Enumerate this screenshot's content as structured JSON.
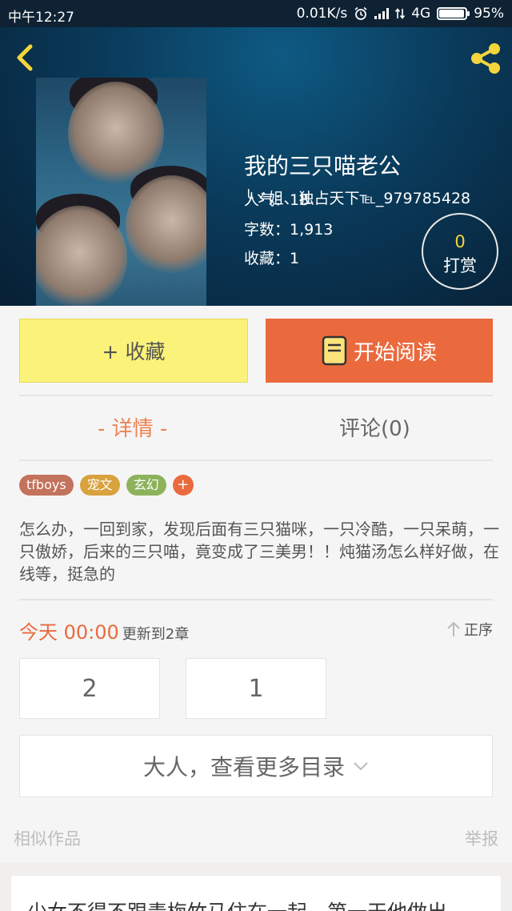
{
  "status_bar": {
    "time": "中午12:27",
    "network_speed": "0.01K/s",
    "network_type": "4G",
    "battery": "95%"
  },
  "header": {
    "back_icon": "chevron-left-icon",
    "share_icon": "share-icon"
  },
  "book": {
    "title": "我的三只喵老公",
    "author": "╰ゞ姐、独占天下℡_979785428",
    "popularity": "人气：18",
    "word_count": "字数：1,913",
    "favorites": "收藏：1"
  },
  "reward": {
    "count": "0",
    "label": "打赏"
  },
  "actions": {
    "favorite": "+ 收藏",
    "read": "开始阅读"
  },
  "tabs": {
    "detail": "- 详情 -",
    "comments": "评论(0)"
  },
  "tags": [
    {
      "label": "tfboys",
      "color": "#c3725c"
    },
    {
      "label": "宠文",
      "color": "#d8a23e"
    },
    {
      "label": "玄幻",
      "color": "#8db25c"
    }
  ],
  "tag_add": "+",
  "description": "怎么办，一回到家，发现后面有三只猫咪，一只冷酷，一只呆萌，一只傲娇，后来的三只喵，竟变成了三美男！！炖猫汤怎么样好做，在线等，挺急的",
  "update": {
    "time": "今天 00:00",
    "text": "更新到2章"
  },
  "sort_order": "正序",
  "chapters": [
    "2",
    "1"
  ],
  "more_catalog": "大人，查看更多目录",
  "similar_works": "相似作品",
  "report": "举报",
  "similar_preview": "少女不得不跟毒梅竹马住在一起，第一天他做出"
}
